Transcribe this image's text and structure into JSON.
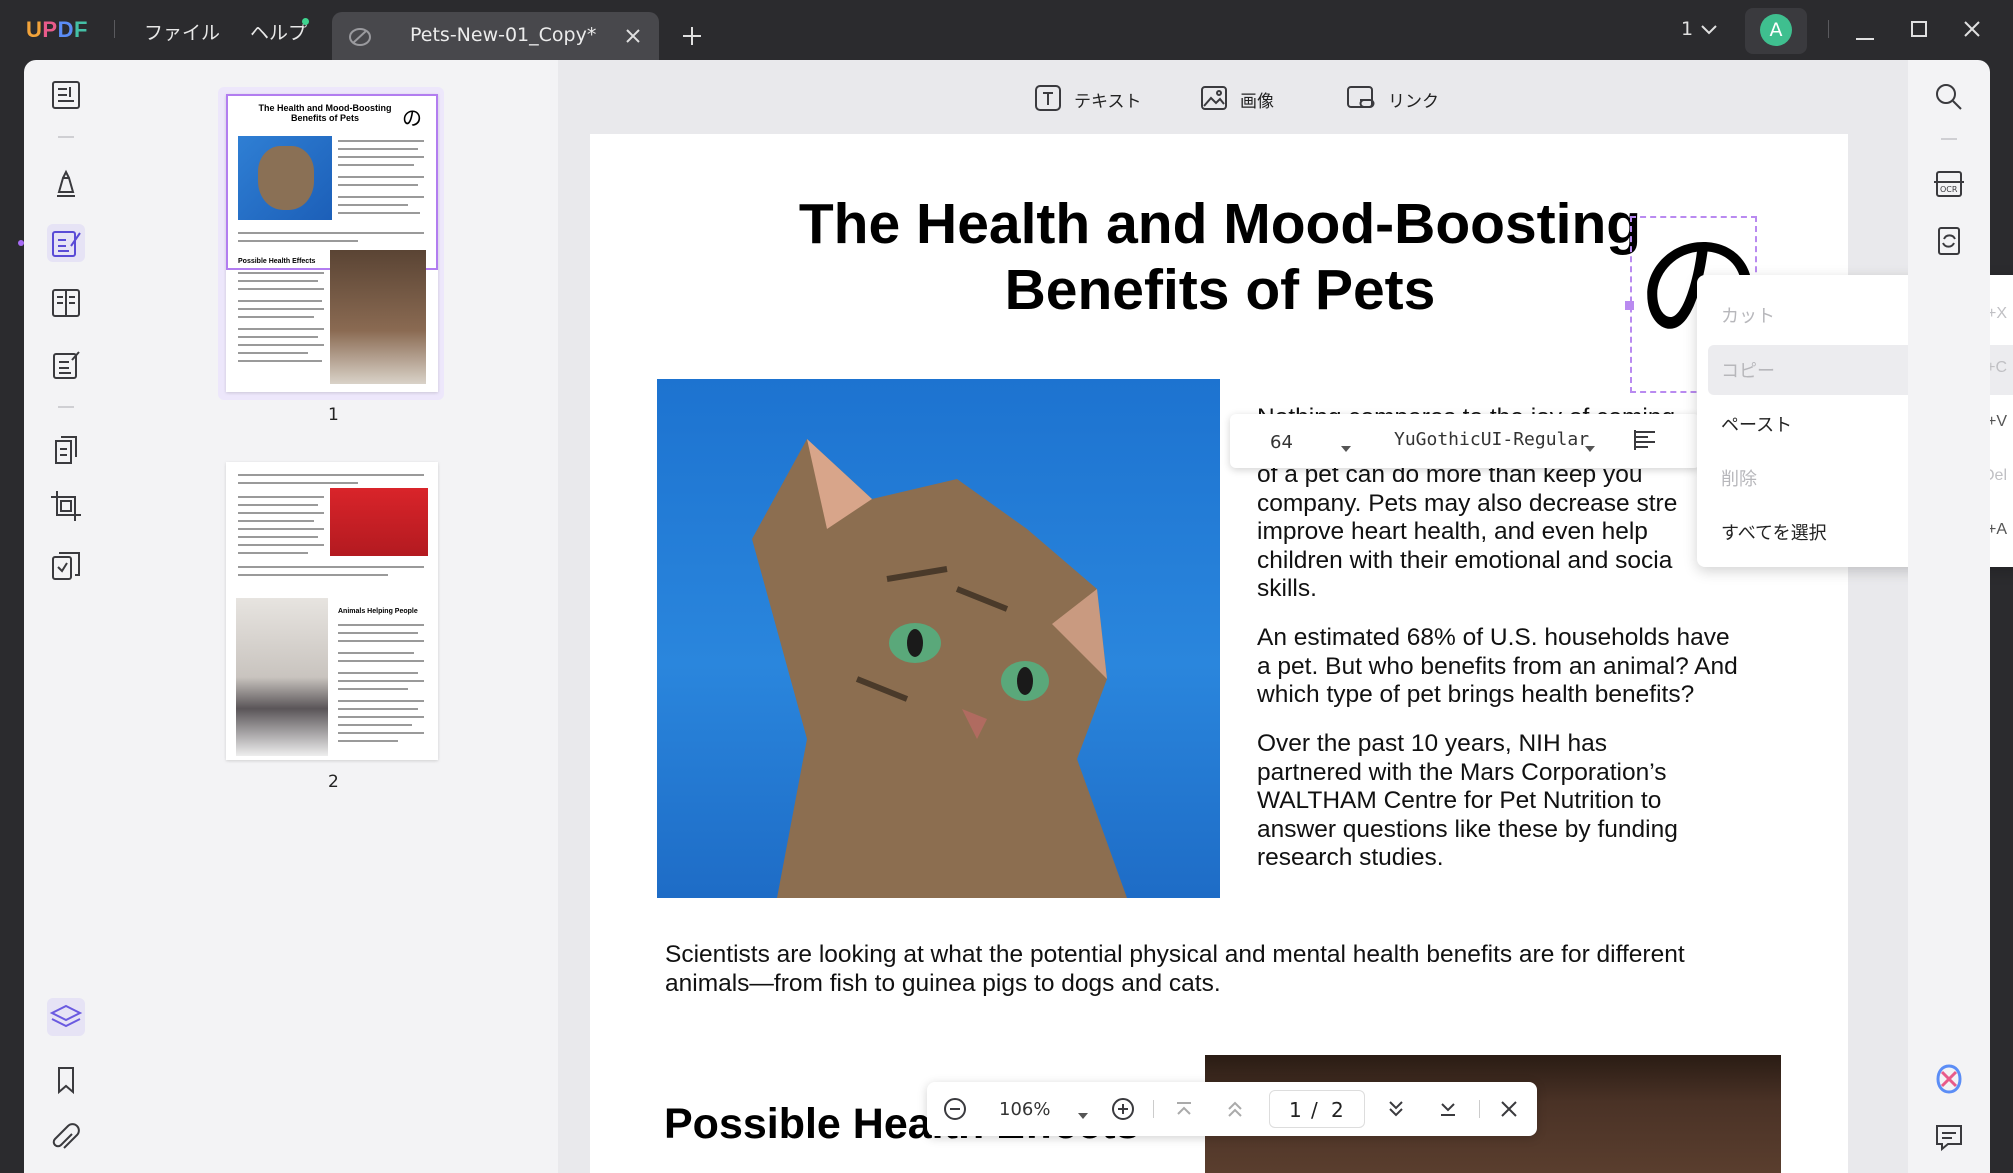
{
  "app": {
    "logo": "UPDF"
  },
  "menu": {
    "file": "ファイル",
    "help": "ヘルプ"
  },
  "tab": {
    "title": "Pets-New-01_Copy*"
  },
  "window": {
    "page_count_label": "1",
    "avatar_letter": "A"
  },
  "edit_toolbar": {
    "text": "テキスト",
    "image": "画像",
    "link": "リンク"
  },
  "thumbnails": {
    "page1_label": "1",
    "page2_label": "2",
    "p1_title": "The Health and Mood-Boosting Benefits of Pets",
    "p1_heading": "Possible Health Effects",
    "p2_heading": "Animals Helping People"
  },
  "page": {
    "title_line1": "The Health and Mood-Boosting",
    "title_line2": "Benefits of Pets",
    "para1_lines": [
      "Nothing compares to the joy of coming home",
      "of a pet can do more than keep you",
      "company. Pets may also decrease stre",
      "improve heart health,  and  even  help",
      "children  with  their emotional and socia",
      "skills."
    ],
    "para2_lines": [
      "An estimated 68% of U.S. households have",
      "a pet. But who benefits from an animal? And",
      "which type of pet brings health benefits?"
    ],
    "para3_lines": [
      "Over  the  past  10  years,  NIH  has",
      "partnered with the Mars Corporation’s",
      "WALTHAM Centre for  Pet  Nutrition  to",
      "answer  questions  like these by funding",
      "research studies."
    ],
    "para4_lines": [
      "Scientists are looking at what the potential physical and mental health benefits are for different",
      "animals—from fish to guinea pigs to dogs and cats."
    ],
    "section_heading": "Possible Health Effects",
    "selected_glyph": "の"
  },
  "text_toolbar": {
    "font_size": "64",
    "font_name": "YuGothicUI-Regular"
  },
  "context_menu": {
    "items": [
      {
        "label": "カット",
        "shortcut": "Ctrl+X",
        "enabled": false
      },
      {
        "label": "コピー",
        "shortcut": "Ctrl+C",
        "enabled": false
      },
      {
        "label": "ペースト",
        "shortcut": "Ctrl+V",
        "enabled": true
      },
      {
        "label": "削除",
        "shortcut": "Del",
        "enabled": false
      },
      {
        "label": "すべてを選択",
        "shortcut": "Ctrl+A",
        "enabled": true
      }
    ]
  },
  "bottom_bar": {
    "zoom": "106%",
    "current_page": "1",
    "separator": "/",
    "total_pages": "2"
  },
  "colors": {
    "accent": "#a76bf5",
    "dark_bg": "#2b2b2e",
    "panel_bg": "#f3f3f5"
  }
}
